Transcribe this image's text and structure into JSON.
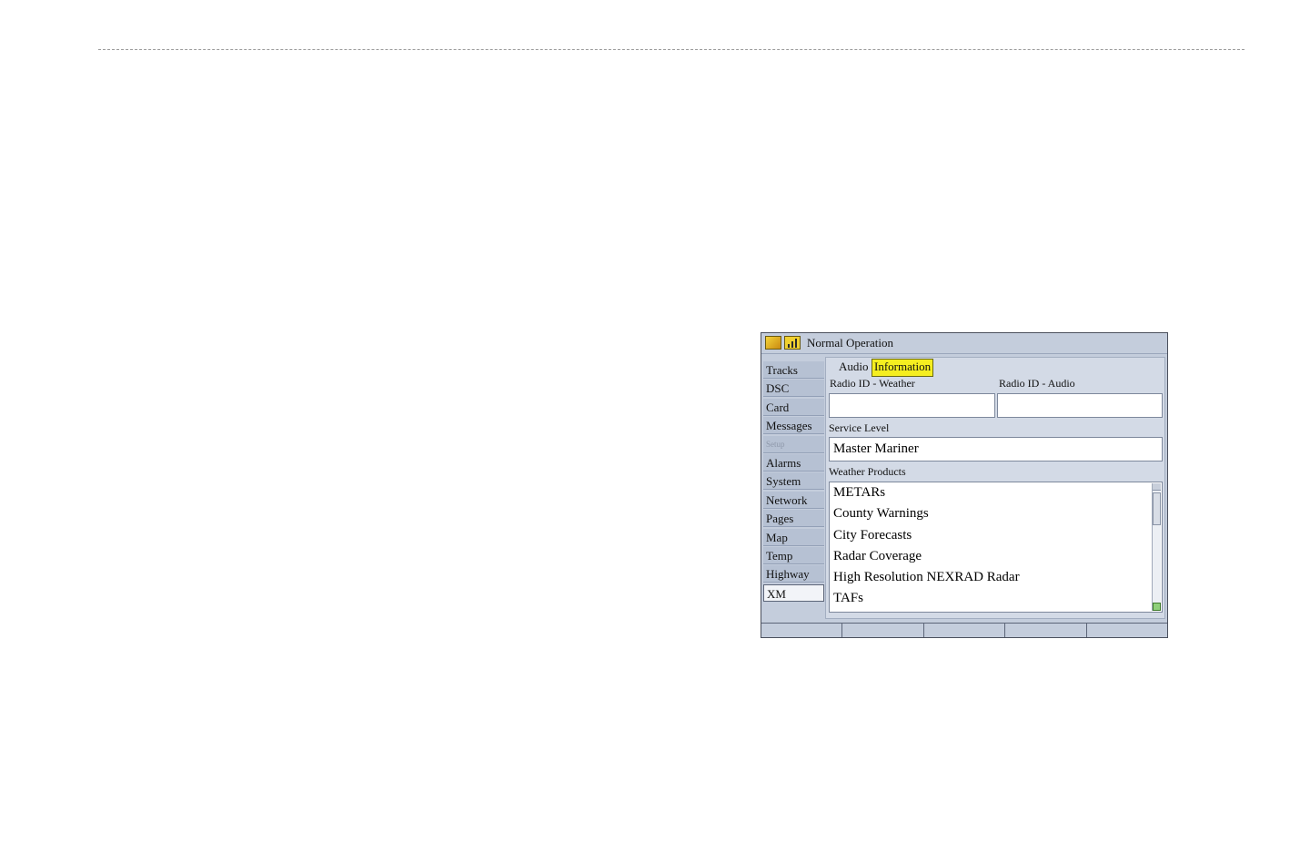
{
  "status": {
    "title": "Normal Operation",
    "icons": [
      "xm-signal-icon",
      "signal-strength-icon"
    ]
  },
  "sidebar": {
    "items": [
      {
        "label": "Tracks"
      },
      {
        "label": "DSC"
      },
      {
        "label": "Card"
      },
      {
        "label": "Messages"
      },
      {
        "label": "Setup"
      },
      {
        "label": "Alarms"
      },
      {
        "label": "System"
      },
      {
        "label": "Network"
      },
      {
        "label": "Pages"
      },
      {
        "label": "Map"
      },
      {
        "label": "Temp"
      },
      {
        "label": "Highway"
      },
      {
        "label": "XM"
      }
    ],
    "selected": "XM"
  },
  "tabs": [
    {
      "label": "Audio"
    },
    {
      "label": "Information",
      "active": true
    }
  ],
  "fields": {
    "radio_id_weather": {
      "label": "Radio ID - Weather",
      "value": ""
    },
    "radio_id_audio": {
      "label": "Radio ID - Audio",
      "value": ""
    },
    "service_level": {
      "label": "Service Level",
      "value": "Master Mariner"
    }
  },
  "weather_products": {
    "label": "Weather Products",
    "items": [
      "METARs",
      "County Warnings",
      "City Forecasts",
      "Radar Coverage",
      "High Resolution NEXRAD Radar",
      "TAFs"
    ]
  },
  "colors": {
    "active_tab": "#f5ee20",
    "screen_bg": "#c4cddc",
    "panel_bg": "#d3dae6"
  }
}
